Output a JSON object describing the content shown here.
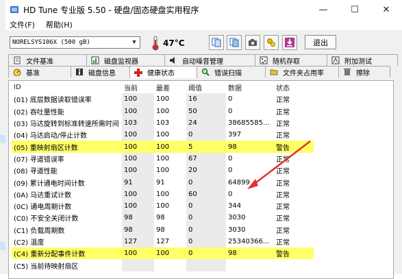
{
  "window": {
    "title": "HD Tune 专业版 5.50 - 硬盘/固态硬盘实用程序",
    "controls": [
      "minimize",
      "maximize",
      "close"
    ]
  },
  "menu": {
    "items": [
      "文件(F)",
      "帮助(H)"
    ]
  },
  "toolbar": {
    "drive": "NORELSYS106X (500 gB)",
    "temperature": "47°C",
    "exit_label": "退出",
    "buttons": [
      "copy-text-icon",
      "copy-screenshot-icon",
      "camera-icon",
      "options-icon",
      "save-icon"
    ]
  },
  "tabs_top": [
    {
      "label": "文件基准",
      "icon": "file-benchmark-icon"
    },
    {
      "label": "磁盘监视器",
      "icon": "disk-monitor-icon"
    },
    {
      "label": "自动噪音管理",
      "icon": "speaker-icon"
    },
    {
      "label": "随机存取",
      "icon": "random-access-icon"
    },
    {
      "label": "附加测试",
      "icon": "extra-tests-icon"
    }
  ],
  "tabs_bottom": [
    {
      "label": "基准",
      "icon": "benchmark-icon"
    },
    {
      "label": "磁盘信息",
      "icon": "info-icon"
    },
    {
      "label": "健康状态",
      "icon": "health-cross-icon",
      "active": true
    },
    {
      "label": "错误扫描",
      "icon": "magnifier-icon"
    },
    {
      "label": "文件夹占用率",
      "icon": "folder-icon"
    },
    {
      "label": "擦除",
      "icon": "trash-icon"
    }
  ],
  "health_table": {
    "columns": [
      "ID",
      "当前",
      "最差",
      "阈值",
      "数据",
      "状态"
    ],
    "rows": [
      {
        "id": "(01) 底层数据读取错误率",
        "current": "100",
        "worst": "100",
        "threshold": "16",
        "data": "0",
        "status": "正常",
        "warn": false
      },
      {
        "id": "(02) 吞吐量性能",
        "current": "100",
        "worst": "100",
        "threshold": "50",
        "data": "0",
        "status": "正常",
        "warn": false
      },
      {
        "id": "(03) 马达旋转到标准转速所需时间",
        "current": "103",
        "worst": "103",
        "threshold": "24",
        "data": "38685585...",
        "status": "正常",
        "warn": false
      },
      {
        "id": "(04) 马达启动/停止计数",
        "current": "100",
        "worst": "100",
        "threshold": "0",
        "data": "397",
        "status": "正常",
        "warn": false
      },
      {
        "id": "(05) 重映射扇区计数",
        "current": "100",
        "worst": "100",
        "threshold": "5",
        "data": "98",
        "status": "警告",
        "warn": true
      },
      {
        "id": "(07) 寻道错误率",
        "current": "100",
        "worst": "100",
        "threshold": "67",
        "data": "0",
        "status": "正常",
        "warn": false
      },
      {
        "id": "(08) 寻道性能",
        "current": "100",
        "worst": "100",
        "threshold": "20",
        "data": "0",
        "status": "正常",
        "warn": false
      },
      {
        "id": "(09) 累计通电时间计数",
        "current": "91",
        "worst": "91",
        "threshold": "0",
        "data": "64899",
        "status": "正常",
        "warn": false
      },
      {
        "id": "(0A) 马达重试计数",
        "current": "100",
        "worst": "100",
        "threshold": "60",
        "data": "0",
        "status": "正常",
        "warn": false
      },
      {
        "id": "(0C) 通电周期计数",
        "current": "100",
        "worst": "100",
        "threshold": "0",
        "data": "344",
        "status": "正常",
        "warn": false
      },
      {
        "id": "(C0) 不安全关闭计数",
        "current": "98",
        "worst": "98",
        "threshold": "0",
        "data": "3030",
        "status": "正常",
        "warn": false
      },
      {
        "id": "(C1) 负载周期数",
        "current": "98",
        "worst": "98",
        "threshold": "0",
        "data": "3030",
        "status": "正常",
        "warn": false
      },
      {
        "id": "(C2) 温度",
        "current": "127",
        "worst": "127",
        "threshold": "0",
        "data": "25340366...",
        "status": "正常",
        "warn": false
      },
      {
        "id": "(C4) 重新分配事件计数",
        "current": "100",
        "worst": "100",
        "threshold": "0",
        "data": "98",
        "status": "警告",
        "warn": true
      },
      {
        "id": "(C5) 当前待映射扇区",
        "current": "",
        "worst": "",
        "threshold": "",
        "data": "",
        "status": "",
        "warn": false
      }
    ]
  },
  "colors": {
    "warning_row": "#ffff66",
    "annotation_arrow": "#e0302a"
  }
}
